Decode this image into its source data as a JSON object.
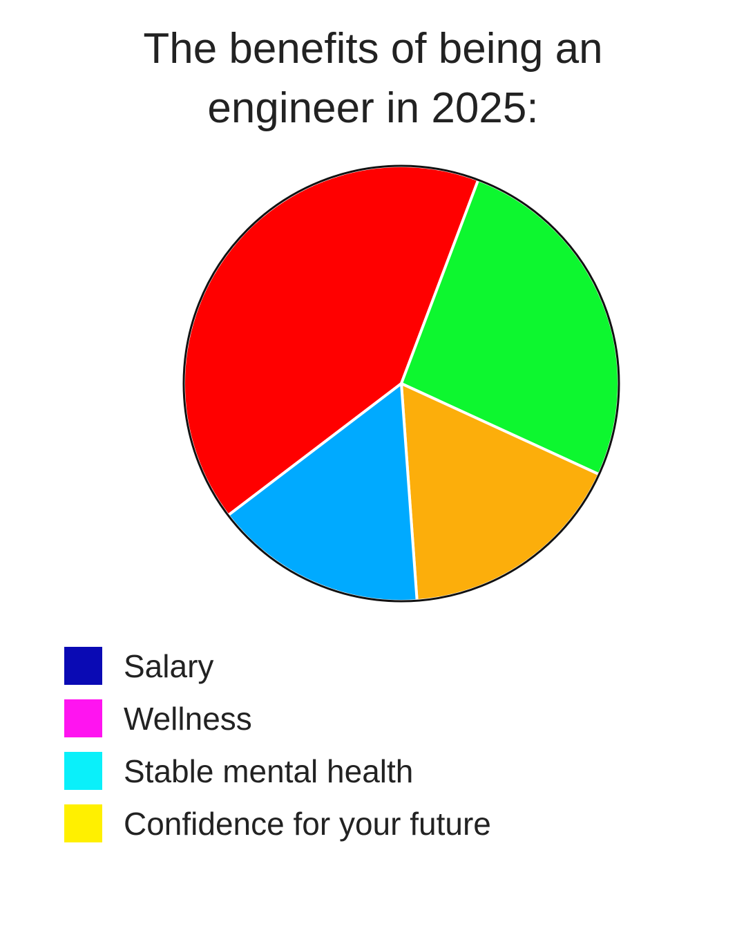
{
  "chart_data": {
    "type": "pie",
    "title_lines": [
      "The benefits of being an",
      "engineer in 2025:"
    ],
    "slices": [
      {
        "color": "#FF0000",
        "value": 41.1
      },
      {
        "color": "#0DF72F",
        "value": 26.1
      },
      {
        "color": "#FCAE0B",
        "value": 17.0
      },
      {
        "color": "#00AAFF",
        "value": 15.8
      }
    ],
    "legend": {
      "placement": "bottom-left",
      "entries": [
        {
          "label": "Salary",
          "color": "#0A0AB4"
        },
        {
          "label": "Wellness",
          "color": "#FF14F0"
        },
        {
          "label": "Stable mental health",
          "color": "#0AF0FA"
        },
        {
          "label": "Confidence for your future",
          "color": "#FFF000"
        }
      ]
    }
  }
}
